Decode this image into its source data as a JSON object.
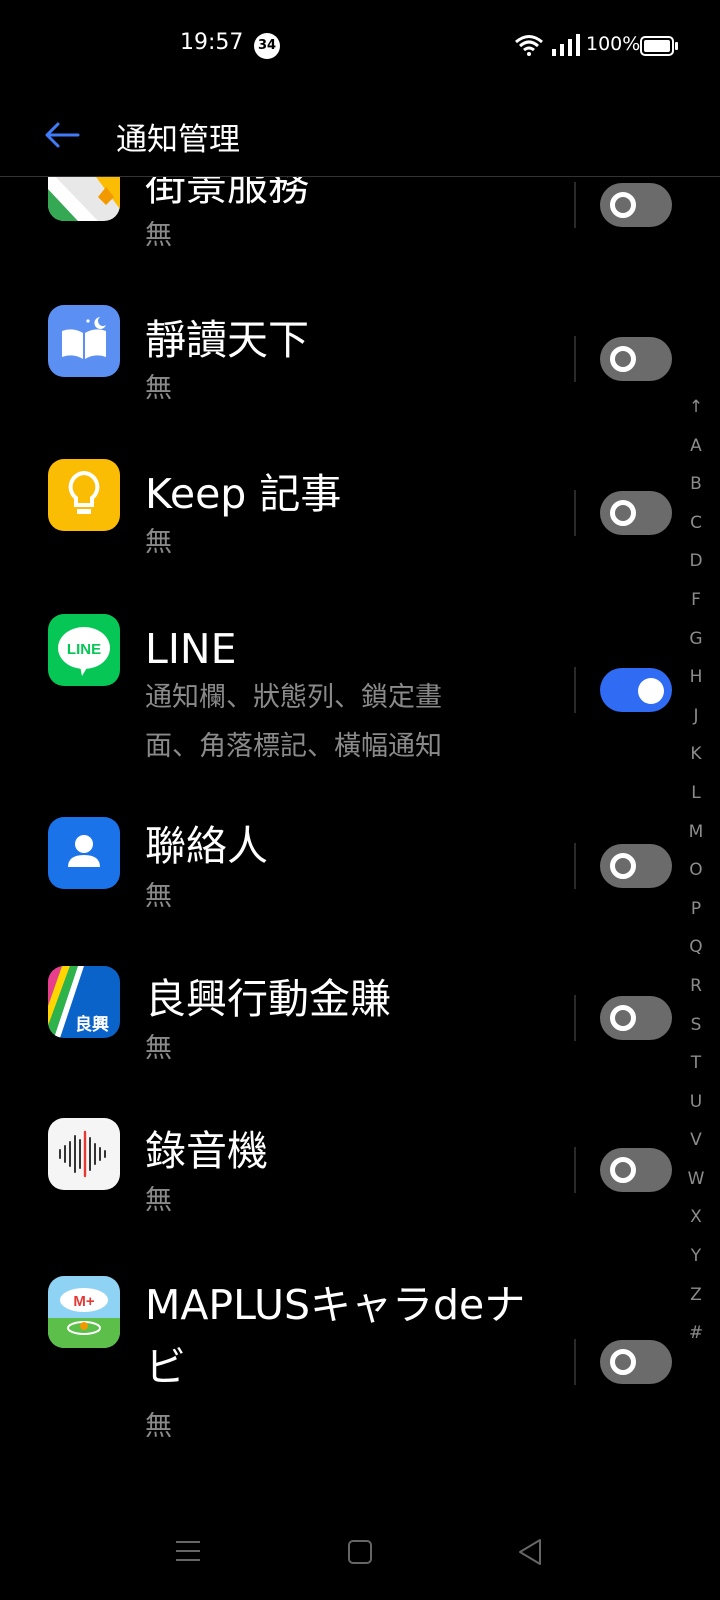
{
  "status_bar": {
    "time": "19:57",
    "notification_count": "34",
    "battery": "100%"
  },
  "header": {
    "title": "通知管理"
  },
  "apps": [
    {
      "name": "街景服務",
      "status": "無",
      "enabled": false,
      "icon": "street-view-icon"
    },
    {
      "name": "靜讀天下",
      "status": "無",
      "enabled": false,
      "icon": "moon-reader-icon"
    },
    {
      "name": "Keep 記事",
      "status": "無",
      "enabled": false,
      "icon": "keep-bulb-icon"
    },
    {
      "name": "LINE",
      "status_line1": "通知欄、狀態列、鎖定畫",
      "status_line2": "面、角落標記、橫幅通知",
      "enabled": true,
      "icon": "line-icon",
      "icon_text": "LINE"
    },
    {
      "name": "聯絡人",
      "status": "無",
      "enabled": false,
      "icon": "contacts-icon"
    },
    {
      "name": "良興行動金賺",
      "status": "無",
      "enabled": false,
      "icon": "eclife-icon",
      "icon_text": "良興"
    },
    {
      "name": "錄音機",
      "status": "無",
      "enabled": false,
      "icon": "recorder-icon"
    },
    {
      "name_line1": "MAPLUSキャラdeナ",
      "name_line2": "ビ",
      "status": "無",
      "enabled": false,
      "icon": "maplus-icon"
    }
  ],
  "alphabet_index": [
    "↑",
    "A",
    "B",
    "C",
    "D",
    "F",
    "G",
    "H",
    "J",
    "K",
    "L",
    "M",
    "O",
    "P",
    "Q",
    "R",
    "S",
    "T",
    "U",
    "V",
    "W",
    "X",
    "Y",
    "Z",
    "#"
  ],
  "colors": {
    "accent": "#2f6bf3",
    "toggle_off": "#6b6b6b",
    "secondary_text": "#8a8a8a"
  }
}
